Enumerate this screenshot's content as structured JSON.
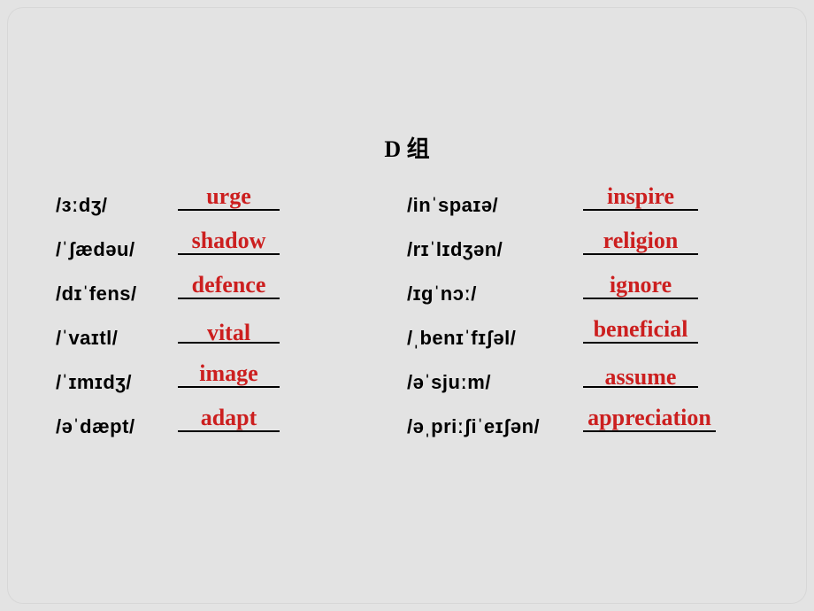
{
  "title": "D 组",
  "left": [
    {
      "phonetic": "/ɜːdʒ/",
      "answer": "urge"
    },
    {
      "phonetic": "/ˈʃædəu/",
      "answer": "shadow"
    },
    {
      "phonetic": "/dɪˈfens/",
      "answer": "defence"
    },
    {
      "phonetic": "/ˈvaɪtl/",
      "answer": "vital"
    },
    {
      "phonetic": "/ˈɪmɪdʒ/",
      "answer": "image"
    },
    {
      "phonetic": "/əˈdæpt/",
      "answer": "adapt"
    }
  ],
  "right": [
    {
      "phonetic": "/inˈspaɪə/",
      "answer": "inspire"
    },
    {
      "phonetic": "/rɪˈlɪdʒən/",
      "answer": "religion"
    },
    {
      "phonetic": "/ɪgˈnɔː/",
      "answer": "ignore"
    },
    {
      "phonetic": "/ˌbenɪˈfɪʃəl/",
      "answer": "beneficial"
    },
    {
      "phonetic": "/əˈsjuːm/",
      "answer": "assume"
    },
    {
      "phonetic": "/əˌpriːʃiˈeɪʃən/",
      "answer": "appreciation"
    }
  ]
}
